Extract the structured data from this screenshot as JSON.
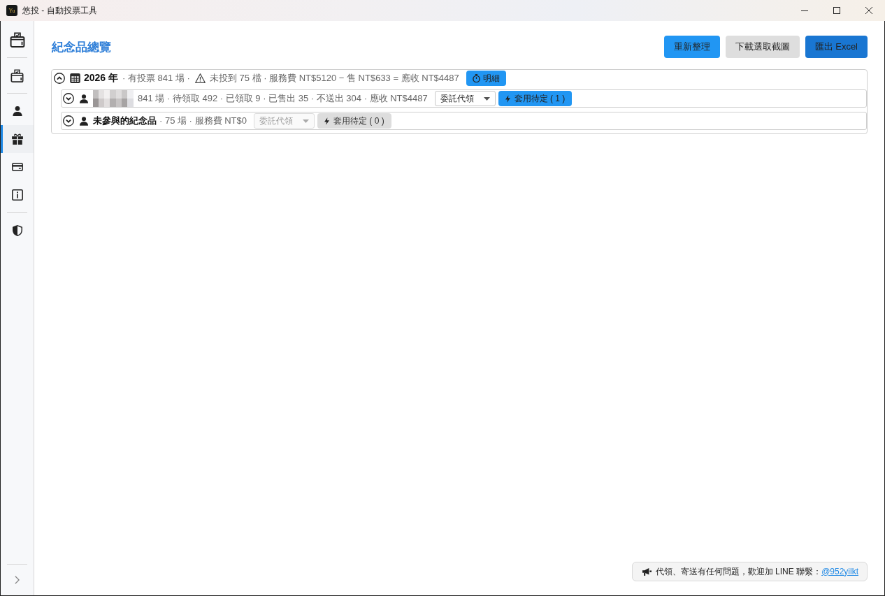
{
  "window": {
    "title": "悠投 - 自動投票工具",
    "logo_text": "Yu"
  },
  "sidebar": {
    "groups": [
      {
        "items": [
          {
            "selected": false
          }
        ]
      },
      {
        "items": [
          {
            "selected": false
          }
        ]
      },
      {
        "items": [
          {
            "selected": false
          },
          {
            "selected": true
          },
          {
            "selected": false
          },
          {
            "selected": false
          }
        ]
      },
      {
        "items": [
          {
            "selected": false
          }
        ]
      }
    ]
  },
  "page": {
    "title": "紀念品總覽",
    "buttons": [
      {
        "label": "重新整理",
        "kind": "primary"
      },
      {
        "label": "下載選取截圖",
        "kind": "secondary"
      },
      {
        "label": "匯出 Excel",
        "kind": "dark"
      }
    ]
  },
  "tree": [
    {
      "label": "2026 年",
      "expanded": true,
      "summary": [
        {
          "text": "· 有投票 841 場 ·",
          "warning": false
        },
        {
          "text": "未投到 75 檔 · 服務費 NT$5120 − 售 NT$633 = 應收 NT$4487",
          "warning": true
        }
      ],
      "detail_button": "明細",
      "children": [
        {
          "name_redacted": true,
          "expanded": false,
          "summary": "841 場 · 待領取 492 · 已領取 9 · 已售出 35 · 不送出 304 · 應收 NT$4487",
          "method": {
            "value": "委託代領",
            "disabled": false
          },
          "apply_button": {
            "label": "套用待定 ( 1 )",
            "disabled": false
          }
        },
        {
          "name": "未參與的紀念品",
          "name_redacted": false,
          "expanded": false,
          "summary": "· 75 場 · 服務費 NT$0",
          "method": {
            "value": "委託代領",
            "disabled": true
          },
          "apply_button": {
            "label": "套用待定 ( 0 )",
            "disabled": true
          }
        }
      ]
    }
  ],
  "notice": {
    "text": "代領、寄送有任何問題，歡迎加 LINE 聯繫：",
    "link": "@952yilkt"
  }
}
